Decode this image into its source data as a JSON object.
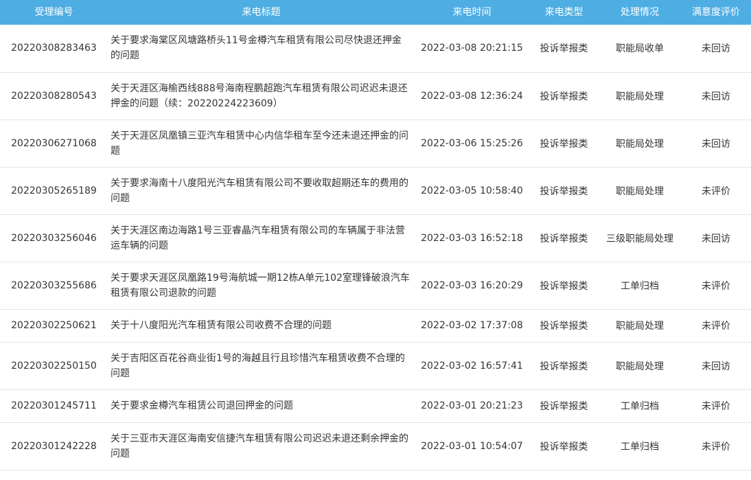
{
  "colors": {
    "header_bg": "#4eaee3",
    "border": "#e2e6ea",
    "text": "#333333"
  },
  "table": {
    "headers": [
      "受理编号",
      "来电标题",
      "来电时间",
      "来电类型",
      "处理情况",
      "满意度评价"
    ],
    "rows": [
      {
        "id": "20220308283463",
        "title": "关于要求海棠区风塘路桥头11号金樽汽车租赁有限公司尽快退还押金的问题",
        "time": "2022-03-08 20:21:15",
        "type": "投诉举报类",
        "status": "职能局收单",
        "rating": "未回访"
      },
      {
        "id": "20220308280543",
        "title": "关于天涯区海榆西线888号海南程鹏超跑汽车租赁有限公司迟迟未退还押金的问题（续：20220224223609）",
        "time": "2022-03-08 12:36:24",
        "type": "投诉举报类",
        "status": "职能局处理",
        "rating": "未回访"
      },
      {
        "id": "20220306271068",
        "title": "关于天涯区凤凰镇三亚汽车租赁中心内信华租车至今还未退还押金的问题",
        "time": "2022-03-06 15:25:26",
        "type": "投诉举报类",
        "status": "职能局处理",
        "rating": "未回访"
      },
      {
        "id": "20220305265189",
        "title": "关于要求海南十八度阳光汽车租赁有限公司不要收取超期还车的费用的问题",
        "time": "2022-03-05 10:58:40",
        "type": "投诉举报类",
        "status": "职能局处理",
        "rating": "未评价"
      },
      {
        "id": "20220303256046",
        "title": "关于天涯区南边海路1号三亚睿晶汽车租赁有限公司的车辆属于非法营运车辆的问题",
        "time": "2022-03-03 16:52:18",
        "type": "投诉举报类",
        "status": "三级职能局处理",
        "rating": "未回访"
      },
      {
        "id": "20220303255686",
        "title": "关于要求天涯区凤凰路19号海航城一期12栋A单元102室理锋破浪汽车租赁有限公司退款的问题",
        "time": "2022-03-03 16:20:29",
        "type": "投诉举报类",
        "status": "工单归档",
        "rating": "未评价"
      },
      {
        "id": "20220302250621",
        "title": "关于十八度阳光汽车租赁有限公司收费不合理的问题",
        "time": "2022-03-02 17:37:08",
        "type": "投诉举报类",
        "status": "职能局处理",
        "rating": "未评价"
      },
      {
        "id": "20220302250150",
        "title": "关于吉阳区百花谷商业街1号的海越且行且珍惜汽车租赁收费不合理的问题",
        "time": "2022-03-02 16:57:41",
        "type": "投诉举报类",
        "status": "职能局处理",
        "rating": "未回访"
      },
      {
        "id": "20220301245711",
        "title": "关于要求金樽汽车租赁公司退回押金的问题",
        "time": "2022-03-01 20:21:23",
        "type": "投诉举报类",
        "status": "工单归档",
        "rating": "未评价"
      },
      {
        "id": "20220301242228",
        "title": "关于三亚市天涯区海南安信捷汽车租赁有限公司迟迟未退还剩余押金的问题",
        "time": "2022-03-01 10:54:07",
        "type": "投诉举报类",
        "status": "工单归档",
        "rating": "未评价"
      }
    ]
  }
}
